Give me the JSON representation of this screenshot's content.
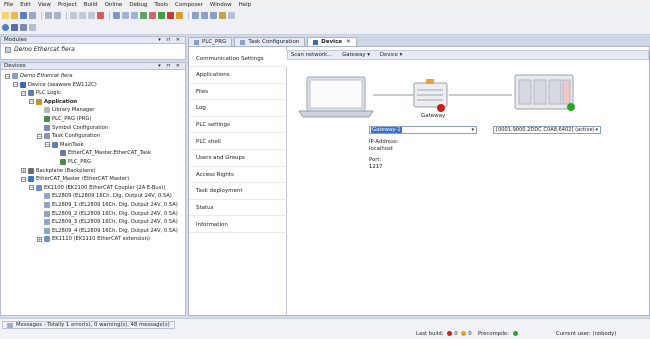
{
  "menu": [
    "File",
    "Edit",
    "View",
    "Project",
    "Build",
    "Online",
    "Debug",
    "Tools",
    "Composer",
    "Window",
    "Help"
  ],
  "modules_panel": {
    "title": "Modules",
    "item": "Demo Ethercat fiera"
  },
  "devices_panel": {
    "title": "Devices",
    "tree": [
      {
        "label": "Demo Ethercat fiera",
        "style": "it",
        "indent": 0,
        "toggle": "-"
      },
      {
        "label": "Device (seaware EW112C)",
        "style": "",
        "indent": 1,
        "toggle": "-"
      },
      {
        "label": "PLC Logic",
        "style": "",
        "indent": 2,
        "toggle": "-"
      },
      {
        "label": "Application",
        "style": "b",
        "indent": 3,
        "toggle": "-"
      },
      {
        "label": "Library Manager",
        "style": "",
        "indent": 4,
        "toggle": ""
      },
      {
        "label": "PLC_PRG (PRG)",
        "style": "",
        "indent": 4,
        "toggle": ""
      },
      {
        "label": "Symbol Configuration",
        "style": "",
        "indent": 4,
        "toggle": ""
      },
      {
        "label": "Task Configuration",
        "style": "",
        "indent": 4,
        "toggle": "-"
      },
      {
        "label": "MainTask",
        "style": "",
        "indent": 5,
        "toggle": "-"
      },
      {
        "label": "EtherCAT_Master.EtherCAT_Task",
        "style": "",
        "indent": 6,
        "toggle": ""
      },
      {
        "label": "PLC_PRG",
        "style": "",
        "indent": 6,
        "toggle": ""
      },
      {
        "label": "Backplane (Backplane)",
        "style": "",
        "indent": 2,
        "toggle": "+"
      },
      {
        "label": "EtherCAT_Master (EtherCAT Master)",
        "style": "",
        "indent": 2,
        "toggle": "-"
      },
      {
        "label": "EK1100 (EK1100 EtherCAT Coupler (2A E-Bus))",
        "style": "",
        "indent": 3,
        "toggle": "-"
      },
      {
        "label": "EL2809 (EL2809 16Ch. Dig. Output 24V, 0.5A)",
        "style": "",
        "indent": 4,
        "toggle": ""
      },
      {
        "label": "EL2809_1 (EL2809 16Ch. Dig. Output 24V, 0.5A)",
        "style": "",
        "indent": 4,
        "toggle": ""
      },
      {
        "label": "EL2809_2 (EL2809 16Ch. Dig. Output 24V, 0.5A)",
        "style": "",
        "indent": 4,
        "toggle": ""
      },
      {
        "label": "EL2809_3 (EL2809 16Ch. Dig. Output 24V, 0.5A)",
        "style": "",
        "indent": 4,
        "toggle": ""
      },
      {
        "label": "EL2809_4 (EL2809 16Ch. Dig. Output 24V, 0.5A)",
        "style": "",
        "indent": 4,
        "toggle": ""
      },
      {
        "label": "EK1110 (EK1110 EtherCAT extension)",
        "style": "",
        "indent": 4,
        "toggle": "+"
      }
    ]
  },
  "tabs": [
    {
      "label": "PLC_PRG",
      "active": false
    },
    {
      "label": "Task Configuration",
      "active": false
    },
    {
      "label": "Device",
      "active": true
    }
  ],
  "device_tabs": [
    "Communication Settings",
    "Applications",
    "Files",
    "Log",
    "PLC settings",
    "PLC shell",
    "Users and Groups",
    "Access Rights",
    "Task deployment",
    "Status",
    "Information"
  ],
  "subbar": {
    "scan": "Scan network...",
    "gateway": "Gateway ▾",
    "device": "Device ▾"
  },
  "comm": {
    "gateway_label": "Gateway",
    "gateway_select": "Gateway-1",
    "device_select": "[0001.9000.2DDC.C0A8.6402] (active)",
    "ip_label": "IP-Address:",
    "ip_value": "localhost",
    "port_label": "Port:",
    "port_value": "1217"
  },
  "status": {
    "messages": "Messages - Totally 1 error(s), 0 warning(s), 48 message(s)",
    "last_build_label": "Last build:",
    "errors": "0",
    "warnings": "0",
    "precompile_label": "Precompile:",
    "current_user": "Current user: (nobody)"
  },
  "colors": {
    "accent": "#1e5fa8",
    "error": "#d11b1b",
    "ok": "#2aa52a",
    "warn": "#e8a317"
  }
}
